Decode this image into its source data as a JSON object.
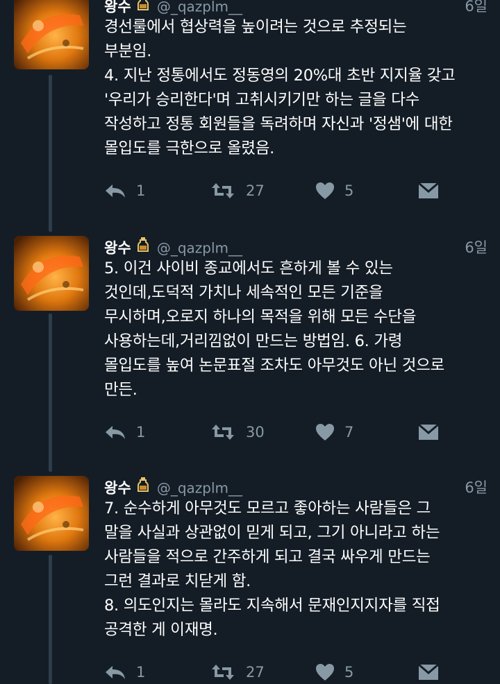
{
  "colors": {
    "background": "#141d26",
    "muted": "#8899a6",
    "thread_line": "#2f3d4b",
    "text": "#ffffff"
  },
  "tweets": [
    {
      "name": "왕수",
      "handle": "@_qazplm__",
      "time": "6일",
      "lines": [
        "경선룰에서 협상력을 높이려는 것으로 추정되는",
        "부분임.",
        "4. 지난 정통에서도 정동영의 20%대 초반 지지율 갖고",
        "'우리가 승리한다'며 고취시키기만 하는 글을 다수",
        "작성하고 정통 회원들을 독려하며 자신과 '정샘'에 대한",
        "몰입도를 극한으로 올렸음."
      ],
      "replies": "1",
      "retweets": "27",
      "likes": "5"
    },
    {
      "name": "왕수",
      "handle": "@_qazplm__",
      "time": "6일",
      "lines": [
        "5. 이건 사이비 종교에서도 흔하게 볼 수 있는",
        "것인데,도덕적 가치나 세속적인 모든 기준을",
        "무시하며,오로지 하나의 목적을 위해 모든 수단을",
        "사용하는데,거리낌없이 만드는 방법임. 6. 가령",
        "몰입도를 높여 논문표절 조차도 아무것도 아닌 것으로",
        "만든."
      ],
      "replies": "1",
      "retweets": "30",
      "likes": "7"
    },
    {
      "name": "왕수",
      "handle": "@_qazplm__",
      "time": "6일",
      "lines": [
        "7. 순수하게 아무것도 모르고 좋아하는 사람들은 그",
        "말을 사실과 상관없이 믿게 되고, 그기 아니라고 하는",
        "사람들을 적으로 간주하게 되고 결국 싸우게 만드는",
        "그런 결과로 치닫게 함.",
        "8. 의도인지는 몰라도 지속해서 문재인지지자를 직접",
        "공격한 게 이재명."
      ],
      "replies": "1",
      "retweets": "27",
      "likes": "5"
    }
  ]
}
